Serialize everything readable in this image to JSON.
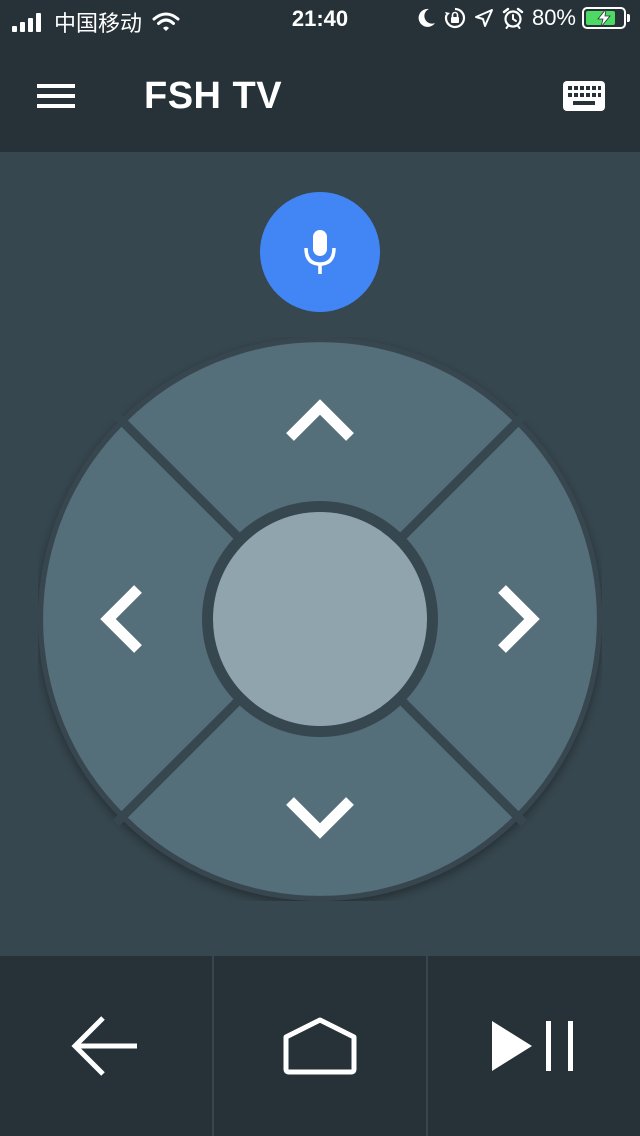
{
  "status_bar": {
    "carrier": "中国移动",
    "time": "21:40",
    "battery_percent": "80%",
    "battery_level": 0.8,
    "icons": [
      "signal-icon",
      "wifi-icon",
      "moon-icon",
      "orientation-lock-icon",
      "location-icon",
      "alarm-icon",
      "battery-charging-icon"
    ]
  },
  "app_bar": {
    "title": "FSH TV",
    "menu_icon": "hamburger-menu-icon",
    "keyboard_icon": "keyboard-icon"
  },
  "remote": {
    "voice_button_icon": "microphone-icon",
    "dpad": [
      "up",
      "down",
      "left",
      "right",
      "select"
    ]
  },
  "bottom_nav": [
    "back-arrow-icon",
    "home-icon",
    "play-pause-icon"
  ],
  "colors": {
    "bar_bg": "#263238",
    "main_bg": "#37474f",
    "dpad_segment": "#546e7a",
    "dpad_center": "#90a4ae",
    "mic_accent": "#4285f4",
    "battery_green": "#4cd964"
  }
}
